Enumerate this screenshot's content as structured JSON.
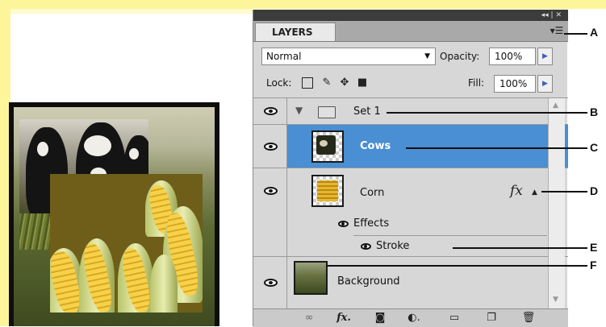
{
  "panel": {
    "strip_buttons": "◂◂ | ✕",
    "tab_label": "LAYERS",
    "menu_icon": "panel-menu-icon",
    "blend_mode": "Normal",
    "opacity_label": "Opacity:",
    "opacity_value": "100%",
    "lock_label": "Lock:",
    "fill_label": "Fill:",
    "fill_value": "100%"
  },
  "layers": [
    {
      "name": "Set 1",
      "kind": "group"
    },
    {
      "name": "Cows",
      "kind": "layer",
      "selected": true
    },
    {
      "name": "Corn",
      "kind": "layer",
      "fx": "fx"
    },
    {
      "name": "Effects",
      "kind": "effects-header"
    },
    {
      "name": "Stroke",
      "kind": "effect"
    },
    {
      "name": "Background",
      "kind": "layer"
    }
  ],
  "callouts": [
    "A",
    "B",
    "C",
    "D",
    "E",
    "F"
  ],
  "colors": {
    "selection": "#4a8ed4",
    "panel_bg": "#d7d7d7",
    "slide_frame": "#fdf59a"
  }
}
